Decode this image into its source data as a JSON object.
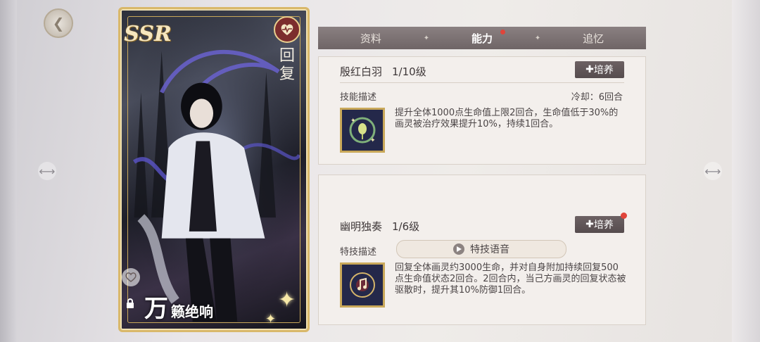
{
  "card": {
    "rarity": "SSR",
    "role": "回复",
    "surname": "万",
    "given_name": "籁绝响"
  },
  "tabs": [
    {
      "label": "资料",
      "active": false
    },
    {
      "label": "能力",
      "active": true
    },
    {
      "label": "追忆",
      "active": false
    }
  ],
  "skill": {
    "name": "殷红白羽",
    "level": "1/10级",
    "train_label": "培养",
    "desc_label": "技能描述",
    "cooldown": "冷却：6回合",
    "description": "提升全体1000点生命值上限2回合，生命值低于30%的画灵被治疗效果提升10%，持续1回合。",
    "icon": "crescent-leaf-icon"
  },
  "special": {
    "section_label": "特技",
    "name": "幽明独奏",
    "level": "1/6级",
    "train_label": "培养",
    "desc_label": "特技描述",
    "voice_label": "特技语音",
    "description": "回复全体画灵约3000生命，并对自身附加持续回复500点生命值状态2回合。2回合内，当己方画灵的回复状态被驱散时，提升其10%防御1回合。",
    "icon": "music-note-emblem-icon"
  },
  "colors": {
    "accent_gold": "#d9b86a",
    "tab_bg": "#7a7071",
    "notify_red": "#e0443a"
  }
}
